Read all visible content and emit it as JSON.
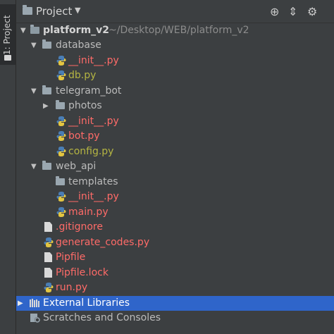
{
  "sidebar": {
    "tab_label": "1: Project"
  },
  "header": {
    "title": "Project",
    "dropdown_glyph": "▼",
    "buttons": [
      {
        "name": "target-icon",
        "glyph": "⊕"
      },
      {
        "name": "collapse-all-icon",
        "glyph": "⇕"
      },
      {
        "name": "gear-icon",
        "glyph": "⚙"
      }
    ]
  },
  "colors": {
    "vcs_modified_red": "#ff6b68",
    "vcs_added_olive": "#b5b542",
    "selection_blue": "#2f65ca",
    "panel_bg": "#3c3f41"
  },
  "tree": {
    "root": {
      "name": "platform_v2",
      "path": "~/Desktop/WEB/platform_v2"
    },
    "items": [
      {
        "label": "database",
        "type": "folder",
        "expanded": true
      },
      {
        "label": "__init__.py",
        "type": "python",
        "status": "modified"
      },
      {
        "label": "db.py",
        "type": "python",
        "status": "added"
      },
      {
        "label": "telegram_bot",
        "type": "folder",
        "expanded": true
      },
      {
        "label": "photos",
        "type": "folder",
        "expanded": false
      },
      {
        "label": "__init__.py",
        "type": "python",
        "status": "modified"
      },
      {
        "label": "bot.py",
        "type": "python",
        "status": "modified"
      },
      {
        "label": "config.py",
        "type": "python",
        "status": "added"
      },
      {
        "label": "web_api",
        "type": "folder",
        "expanded": true
      },
      {
        "label": "templates",
        "type": "folder",
        "expanded": false
      },
      {
        "label": "__init__.py",
        "type": "python",
        "status": "modified"
      },
      {
        "label": "main.py",
        "type": "python",
        "status": "modified"
      },
      {
        "label": ".gitignore",
        "type": "file",
        "status": "modified"
      },
      {
        "label": "generate_codes.py",
        "type": "python",
        "status": "modified"
      },
      {
        "label": "Pipfile",
        "type": "file",
        "status": "modified"
      },
      {
        "label": "Pipfile.lock",
        "type": "file",
        "status": "modified"
      },
      {
        "label": "run.py",
        "type": "python",
        "status": "modified"
      },
      {
        "label": "External Libraries",
        "type": "libraries",
        "selected": true
      },
      {
        "label": "Scratches and Consoles",
        "type": "scratches"
      }
    ]
  }
}
